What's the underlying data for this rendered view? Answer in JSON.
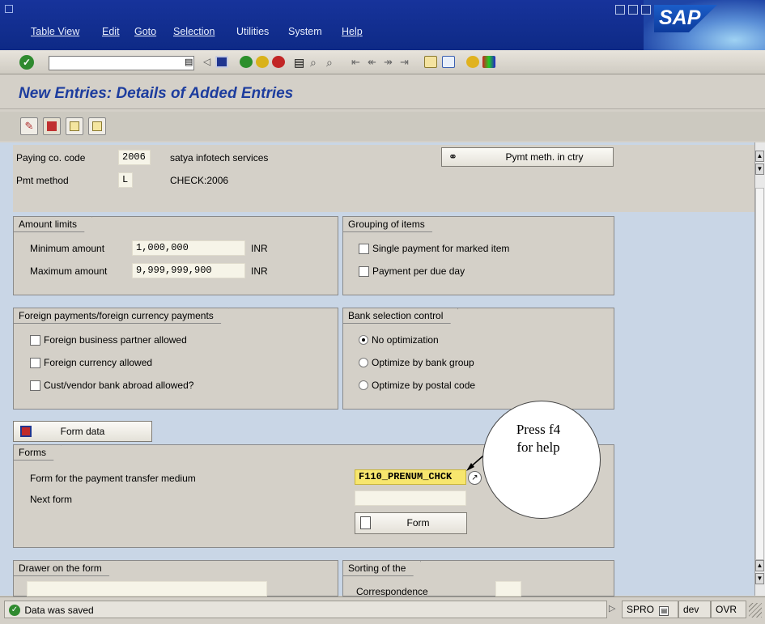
{
  "menu": {
    "items": [
      "Table View",
      "Edit",
      "Goto",
      "Selection",
      "Utilities",
      "System",
      "Help"
    ],
    "logo": "SAP"
  },
  "page_title": "New Entries: Details of Added Entries",
  "header": {
    "paying_code_label": "Paying co. code",
    "paying_code_value": "2006",
    "company_name": "satya infotech services",
    "pmt_method_label": "Pmt method",
    "pmt_method_value": "L",
    "pmt_method_desc": "CHECK:2006",
    "pymt_button": "Pymt meth. in ctry"
  },
  "amount_limits": {
    "title": "Amount limits",
    "min_label": "Minimum amount",
    "min_value": "1,000,000",
    "min_currency": "INR",
    "max_label": "Maximum amount",
    "max_value": "9,999,999,900",
    "max_currency": "INR"
  },
  "grouping": {
    "title": "Grouping of items",
    "single_payment": "Single payment for marked item",
    "per_due_day": "Payment per due day"
  },
  "foreign": {
    "title": "Foreign payments/foreign currency payments",
    "partner": "Foreign business partner allowed",
    "currency": "Foreign currency allowed",
    "bank_abroad": "Cust/vendor bank abroad allowed?"
  },
  "bank_selection": {
    "title": "Bank selection control",
    "no_opt": "No optimization",
    "by_group": "Optimize by bank group",
    "by_postal": "Optimize by postal code",
    "selected": "No optimization"
  },
  "form_data_button": "Form data",
  "forms": {
    "title": "Forms",
    "transfer_label": "Form for the payment transfer medium",
    "transfer_value": "F110_PRENUM_CHCK",
    "next_label": "Next form",
    "next_value": "",
    "form_button": "Form"
  },
  "callout": "Press f4 for help",
  "drawer": {
    "title": "Drawer on the form"
  },
  "sorting": {
    "title": "Sorting of the",
    "correspondence": "Correspondence"
  },
  "status": {
    "message": "Data was saved",
    "system": "SPRO",
    "client": "dev",
    "mode": "OVR"
  },
  "colors": {
    "menubar": "#0e2a86",
    "title": "#1d3d9e",
    "work_bg": "#c9d6e6",
    "group_bg": "#d4d0c8",
    "highlight_field": "#f7e66e"
  }
}
